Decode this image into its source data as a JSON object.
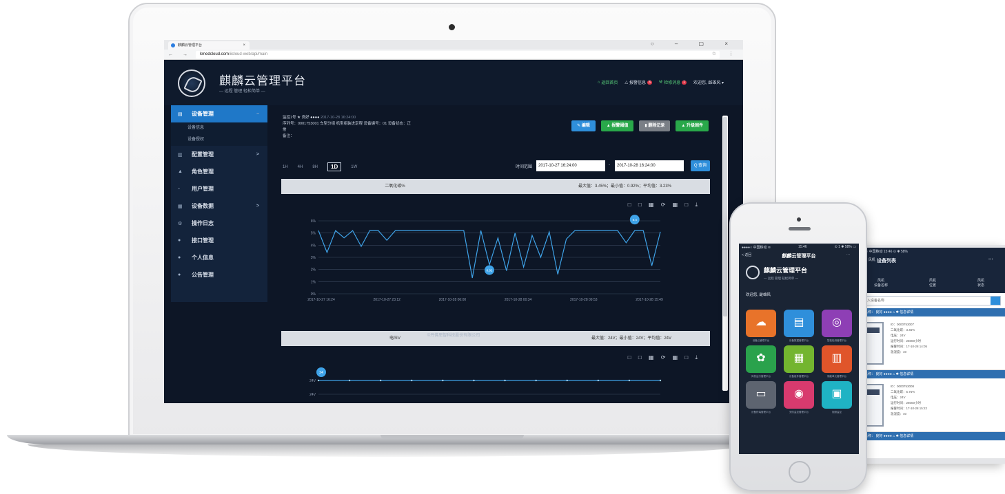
{
  "browser": {
    "tab_title": "麒麟云管理平台",
    "tab_close": "×",
    "window_controls": "○ – ▢ ×",
    "url_host": "kmedcloud.com",
    "url_path": "/iicloud-web/api/main",
    "nav_buttons": "← → C ⓘ",
    "addr_right": "☆ ⋮"
  },
  "app": {
    "title": "麒麟云管理平台",
    "subtitle": "— 远程 管理 轻松简单 —",
    "header": {
      "home": "返回首页",
      "alarm": "报警信息",
      "alarm_count": "3",
      "maintain": "检修消息",
      "maintain_count": "1",
      "welcome": "欢迎您, 雌雄风 ▾"
    }
  },
  "sidebar": {
    "items": [
      {
        "icon": "▤",
        "label": "设备管理",
        "active": true,
        "chev": "–"
      },
      {
        "icon": "",
        "label": "设备信息",
        "sub": true
      },
      {
        "icon": "",
        "label": "设备授权",
        "sub": true
      },
      {
        "icon": "▥",
        "label": "配置管理",
        "chev": ">"
      },
      {
        "icon": "▲",
        "label": "角色管理"
      },
      {
        "icon": "▫",
        "label": "用户管理"
      },
      {
        "icon": "▦",
        "label": "设备数据",
        "chev": ">"
      },
      {
        "icon": "⚙",
        "label": "操作日志"
      },
      {
        "icon": "●",
        "label": "接口管理"
      },
      {
        "icon": "●",
        "label": "个人信息"
      },
      {
        "icon": "●",
        "label": "公告管理"
      }
    ]
  },
  "device": {
    "line1_prefix": "监控1号",
    "line1_status": "良好",
    "line1_stars": "●●●●",
    "line1_time": "2017-10-28 16:24:00",
    "line2": "序列号：0001753001  车型分组  机型组装进定程  设备编号：01  设备状态：正",
    "line3": "常",
    "line4": "备注："
  },
  "actions": {
    "edit": "✎ 编辑",
    "alarm_set": "▲ 报警阈值",
    "delete_record": "▮ 删除记录",
    "upgrade": "▲ 升级固件"
  },
  "range": {
    "options": [
      "1H",
      "4H",
      "8H",
      "1D",
      "1W"
    ],
    "selected": "1D",
    "time_label": "时间范围",
    "start": "2017-10-27 16:24:00",
    "separator": "-",
    "end": "2017-10-28 16:24:00",
    "query": "Q 查询"
  },
  "chart_tools": "□ □ ▦ ⟳ ▦ □ ⤓",
  "chart_data": [
    {
      "type": "line",
      "title": "二氧化碳%",
      "stats": "最大值：3.45%；最小值：0.92%；平均值：3.23%",
      "x_ticks": [
        "2017-10-27 16:24",
        "2017-10-27 23:12",
        "2017-10-28 06:00",
        "2017-10-28 00:34",
        "2017-10-28 09:53",
        "2017-10-28 15:49"
      ],
      "y_ticks": [
        "0%",
        "1%",
        "2%",
        "3%",
        "4%",
        "5%",
        "6%"
      ],
      "ylim": [
        0,
        6
      ],
      "series": [
        {
          "values": [
            5.2,
            3.4,
            5.2,
            4.6,
            5.2,
            3.9,
            5.2,
            5.2,
            4.4,
            5.2,
            5.2,
            5.2,
            5.2,
            5.2,
            5.2,
            5.2,
            5.2,
            5.2,
            1.3,
            5.2,
            2.4,
            4.6,
            1.9,
            5.0,
            2.2,
            4.8,
            3.0,
            5.1,
            1.6,
            4.5,
            5.2,
            5.2,
            5.2,
            5.2,
            5.2,
            5.2,
            4.2,
            5.2,
            5.2,
            2.3,
            5.1
          ]
        }
      ],
      "max_label": "5.4",
      "min_label": "0.92",
      "max_index": 37,
      "min_index": 20
    },
    {
      "type": "line",
      "title": "电压V",
      "stats": "最大值：24V；最小值：24V；平均值：24V",
      "y_ticks": [
        "24V",
        "24V"
      ],
      "series": [
        {
          "values": [
            24,
            24,
            24,
            24,
            24,
            24,
            24,
            24,
            24,
            24,
            24,
            24
          ]
        }
      ],
      "marker_label": "24"
    }
  ],
  "footer": "©丹佛思智科技股份有限公司",
  "phone_main": {
    "status_left": "●●●●○ 中国移动 ≋",
    "status_time": "15:46",
    "status_right": "⊙ 1 ✱ 58% ▭",
    "back": "< 返回",
    "nav_title": "麒麟云管理平台",
    "nav_more": "···",
    "brand_title": "麒麟云管理平台",
    "brand_sub": "— 远程 管理 轻松简单 —",
    "greeting": "欢迎您, 雌雄风",
    "tiles": [
      {
        "color": "#e8732a",
        "glyph": "☁",
        "caption": "设备云管理平台"
      },
      {
        "color": "#2f8fdb",
        "glyph": "▤",
        "caption": "设备数据管理平台"
      },
      {
        "color": "#8e3fb5",
        "glyph": "◎",
        "caption": "智能检测管理平台"
      },
      {
        "color": "#2aa24c",
        "glyph": "✿",
        "caption": "风机运行管理平台"
      },
      {
        "color": "#73b52f",
        "glyph": "▦",
        "caption": "设备组件管理平台"
      },
      {
        "color": "#e0552a",
        "glyph": "▥",
        "caption": "储能单元管理平台"
      },
      {
        "color": "#5d6470",
        "glyph": "▭",
        "caption": "设备终端管理平台"
      },
      {
        "color": "#d83a6e",
        "glyph": "◉",
        "caption": "安防监控管理平台"
      },
      {
        "color": "#1fb3c4",
        "glyph": "▣",
        "caption": "视频监控"
      }
    ]
  },
  "phone_list": {
    "status": "●●●●○ 中国移动    15:46    ⊙ ✱ 58%",
    "back": "< 返回 风机",
    "title": "设备列表",
    "more": "···",
    "tabs": [
      "风机\n设备名称",
      "风机\n位置",
      "风机\n状态"
    ],
    "search_placeholder": "请输入设备名称",
    "cards": [
      {
        "head": "设备名称：  良好 ●●●●      ⌂ ✱ 信息详情",
        "lines": [
          "ID：0000753007",
          "二氧化碳：3.45%",
          "电压：24V",
          "运行时间：26000小时",
          "报警时间：17-10-28 14:05",
          "温湿度：40"
        ]
      },
      {
        "head": "设备名称：  良好 ●●●●      ⌂ ✱ 信息详情",
        "lines": [
          "ID：0000753008",
          "二氧化碳：5.75%",
          "电压：24V",
          "运行时间：26000小时",
          "报警时间：17-10-28 15:22",
          "温湿度：40"
        ]
      }
    ],
    "last_head": "设备名称：  良好 ●●●●      ⌂ ✱ 信息详情"
  }
}
